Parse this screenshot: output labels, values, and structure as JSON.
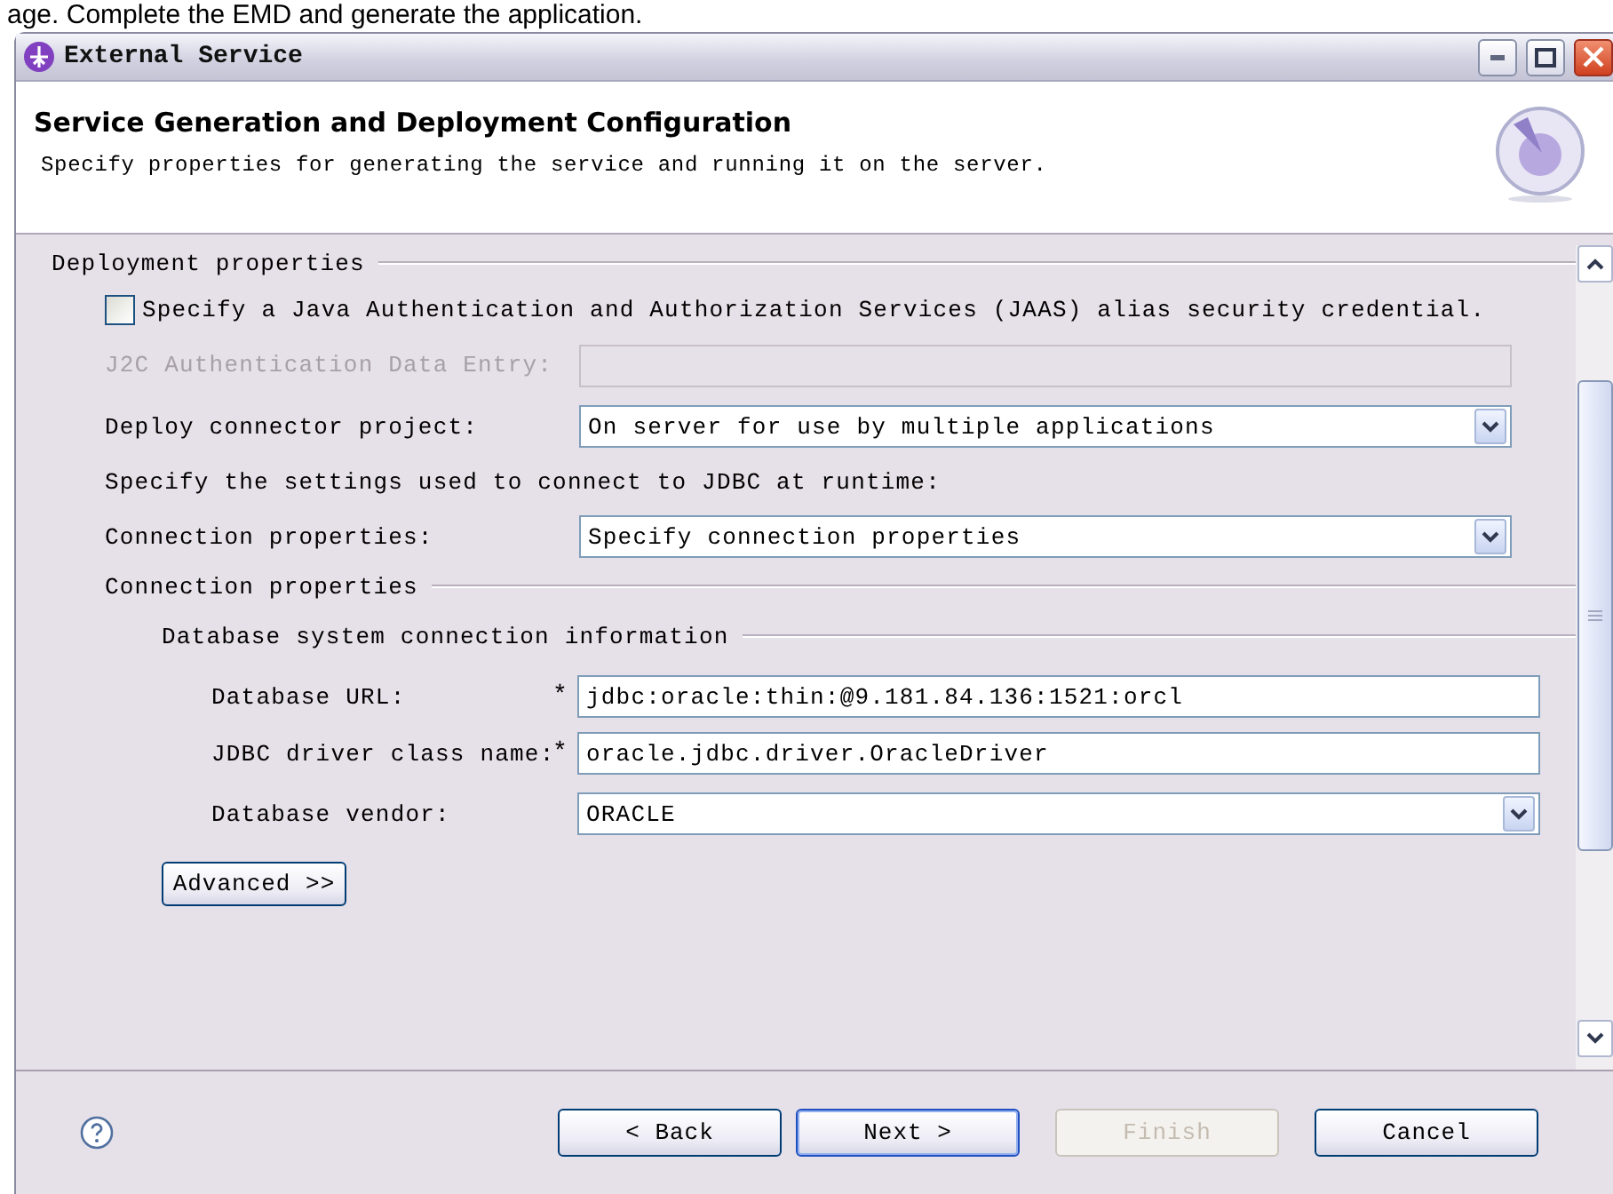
{
  "caption": "age. Complete the EMD and generate the application.",
  "window": {
    "title": "External Service"
  },
  "header": {
    "title": "Service Generation and Deployment Configuration",
    "description": "Specify properties for generating the service and running it on the server."
  },
  "deployment": {
    "legend": "Deployment properties",
    "jaas": {
      "label": "Specify a Java Authentication and Authorization Services (JAAS) alias security credential.",
      "checked": false
    },
    "j2c": {
      "label": "J2C Authentication Data Entry:",
      "disabled": true
    },
    "deploy_connector": {
      "label": "Deploy connector project:",
      "value": "On server for use by multiple applications"
    },
    "jdbc_note": "Specify the settings used to connect to JDBC at runtime:",
    "connection": {
      "label": "Connection properties:",
      "value": "Specify connection properties"
    },
    "connection_group": {
      "legend": "Connection properties",
      "db_group": {
        "legend": "Database system connection information",
        "fields": [
          {
            "kind": "text",
            "label": "Database URL:",
            "marker": "*",
            "value": "jdbc:oracle:thin:@9.181.84.136:1521:orcl"
          },
          {
            "kind": "text",
            "label": "JDBC driver class name:",
            "marker": "*",
            "value": "oracle.jdbc.driver.OracleDriver"
          },
          {
            "kind": "select",
            "label": "Database vendor:",
            "value": "ORACLE"
          }
        ]
      },
      "advanced": "Advanced >>"
    }
  },
  "buttons": [
    {
      "label": "< Back",
      "default": false,
      "disabled": false
    },
    {
      "label": "Next >",
      "default": true,
      "disabled": false
    },
    {
      "label": "Finish",
      "default": false,
      "disabled": true
    },
    {
      "label": "Cancel",
      "default": false,
      "disabled": false
    }
  ]
}
